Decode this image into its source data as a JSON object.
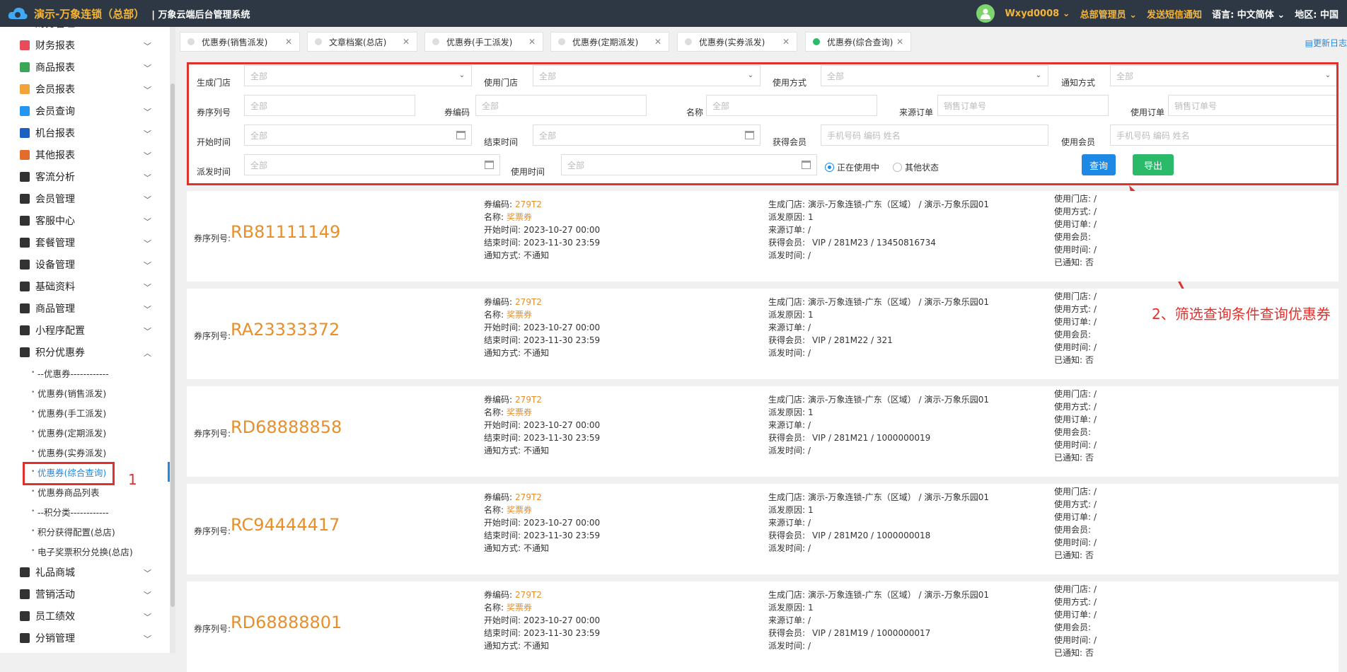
{
  "header": {
    "brand": "演示-万象连锁（总部）",
    "separator": "|",
    "system_name": "万象云端后台管理系统",
    "user": "Wxyd0008",
    "role": "总部管理员",
    "sms": "发送短信通知",
    "language_label": "语言:",
    "language": "中文简体",
    "region_label": "地区:",
    "region": "中国"
  },
  "sidebar": {
    "cut_top": "财务管理",
    "items": [
      {
        "label": "财务报表",
        "icon": "bar-chart-icon",
        "color": "#e84c5a"
      },
      {
        "label": "商品报表",
        "icon": "bar-chart-icon",
        "color": "#3aa757"
      },
      {
        "label": "会员报表",
        "icon": "bar-chart-icon",
        "color": "#f2a33a"
      },
      {
        "label": "会员查询",
        "icon": "bar-chart-icon",
        "color": "#2196f3"
      },
      {
        "label": "机台报表",
        "icon": "bar-chart-icon",
        "color": "#1e5fc2"
      },
      {
        "label": "其他报表",
        "icon": "stack-icon",
        "color": "#e36b2c"
      },
      {
        "label": "客流分析",
        "icon": "target-icon",
        "color": "#333"
      },
      {
        "label": "会员管理",
        "icon": "user-icon",
        "color": "#333"
      },
      {
        "label": "客服中心",
        "icon": "headset-icon",
        "color": "#333"
      },
      {
        "label": "套餐管理",
        "icon": "edit-icon",
        "color": "#333"
      },
      {
        "label": "设备管理",
        "icon": "wrench-icon",
        "color": "#333"
      },
      {
        "label": "基础资料",
        "icon": "doc-icon",
        "color": "#333"
      },
      {
        "label": "商品管理",
        "icon": "swap-icon",
        "color": "#333"
      },
      {
        "label": "小程序配置",
        "icon": "gear-icon",
        "color": "#333"
      },
      {
        "label": "积分优惠券",
        "icon": "tag-icon",
        "color": "#333"
      }
    ],
    "subitems": [
      "--优惠券------------",
      "优惠券(销售派发)",
      "优惠券(手工派发)",
      "优惠券(定期派发)",
      "优惠券(实券派发)",
      "优惠券(综合查询)",
      "优惠券商品列表",
      "--积分类------------",
      "积分获得配置(总店)",
      "电子奖票积分兑换(总店)"
    ],
    "items_after": [
      {
        "label": "礼品商城",
        "icon": "tag-icon"
      },
      {
        "label": "营销活动",
        "icon": "tag-icon"
      },
      {
        "label": "员工绩效",
        "icon": "gear-icon"
      },
      {
        "label": "分销管理",
        "icon": "users-icon"
      }
    ]
  },
  "tabs": [
    {
      "label": "优惠券(销售派发)",
      "active": false
    },
    {
      "label": "文章档案(总店)",
      "active": false
    },
    {
      "label": "优惠券(手工派发)",
      "active": false
    },
    {
      "label": "优惠券(定期派发)",
      "active": false
    },
    {
      "label": "优惠券(实券派发)",
      "active": false
    },
    {
      "label": "优惠券(综合查询)",
      "active": true
    }
  ],
  "update_log": "更新日志",
  "filters": {
    "gen_store": {
      "label": "生成门店",
      "value": "全部"
    },
    "use_store": {
      "label": "使用门店",
      "value": "全部"
    },
    "use_method": {
      "label": "使用方式",
      "value": "全部"
    },
    "notify_method": {
      "label": "通知方式",
      "value": "全部"
    },
    "serial": {
      "label": "券序列号",
      "placeholder": "全部"
    },
    "code": {
      "label": "券编码",
      "placeholder": "全部"
    },
    "name": {
      "label": "名称",
      "placeholder": "全部"
    },
    "src_order": {
      "label": "来源订单",
      "placeholder": "销售订单号"
    },
    "use_order": {
      "label": "使用订单",
      "placeholder": "销售订单号"
    },
    "start_time": {
      "label": "开始时间",
      "placeholder": "全部"
    },
    "end_time": {
      "label": "结束时间",
      "placeholder": "全部"
    },
    "gain_member": {
      "label": "获得会员",
      "placeholder": "手机号码 编码 姓名"
    },
    "use_member": {
      "label": "使用会员",
      "placeholder": "手机号码 编码 姓名"
    },
    "dispatch_time": {
      "label": "派发时间",
      "placeholder": "全部"
    },
    "use_time": {
      "label": "使用时间",
      "placeholder": "全部"
    },
    "radio_using": "正在使用中",
    "radio_other": "其他状态",
    "query_button": "查询",
    "export_button": "导出",
    "query_color": "#1e88e5",
    "export_color": "#2bba6a"
  },
  "labels": {
    "serial_label": "券序列号:",
    "code": "券编码:",
    "name": "名称:",
    "start": "开始时间:",
    "end": "结束时间:",
    "notify": "通知方式:",
    "gen_store": "生成门店:",
    "dispatch_reason": "派发原因:",
    "src_order": "来源订单:",
    "gain_member": "获得会员:",
    "dispatch_time": "派发时间:",
    "use_store": "使用门店:",
    "use_method": "使用方式:",
    "use_order": "使用订单:",
    "use_member": "使用会员:",
    "use_time": "使用时间:",
    "notified": "已通知:"
  },
  "coupons": [
    {
      "serial": "RB81111149",
      "code": "279T2",
      "name": "奖票券",
      "start": "2023-10-27 00:00",
      "end": "2023-11-30 23:59",
      "notify": "不通知",
      "gen_store": "演示-万象连锁-广东（区域） / 演示-万象乐园01",
      "dispatch_reason": "1",
      "src_order": "/",
      "gain_member": "VIP / 281M23 / 13450816734",
      "dispatch_time": "/",
      "use_store": "/",
      "use_method": "/",
      "use_order": "/",
      "use_member": "",
      "use_time": "/",
      "notified": "否"
    },
    {
      "serial": "RA23333372",
      "code": "279T2",
      "name": "奖票券",
      "start": "2023-10-27 00:00",
      "end": "2023-11-30 23:59",
      "notify": "不通知",
      "gen_store": "演示-万象连锁-广东（区域） / 演示-万象乐园01",
      "dispatch_reason": "1",
      "src_order": "/",
      "gain_member": "VIP / 281M22 / 321",
      "dispatch_time": "/",
      "use_store": "/",
      "use_method": "/",
      "use_order": "/",
      "use_member": "",
      "use_time": "/",
      "notified": "否"
    },
    {
      "serial": "RD68888858",
      "code": "279T2",
      "name": "奖票券",
      "start": "2023-10-27 00:00",
      "end": "2023-11-30 23:59",
      "notify": "不通知",
      "gen_store": "演示-万象连锁-广东（区域） / 演示-万象乐园01",
      "dispatch_reason": "1",
      "src_order": "/",
      "gain_member": "VIP / 281M21 / 1000000019",
      "dispatch_time": "/",
      "use_store": "/",
      "use_method": "/",
      "use_order": "/",
      "use_member": "",
      "use_time": "/",
      "notified": "否"
    },
    {
      "serial": "RC94444417",
      "code": "279T2",
      "name": "奖票券",
      "start": "2023-10-27 00:00",
      "end": "2023-11-30 23:59",
      "notify": "不通知",
      "gen_store": "演示-万象连锁-广东（区域） / 演示-万象乐园01",
      "dispatch_reason": "1",
      "src_order": "/",
      "gain_member": "VIP / 281M20 / 1000000018",
      "dispatch_time": "/",
      "use_store": "/",
      "use_method": "/",
      "use_order": "/",
      "use_member": "",
      "use_time": "/",
      "notified": "否"
    },
    {
      "serial": "RD68888801",
      "code": "279T2",
      "name": "奖票券",
      "start": "2023-10-27 00:00",
      "end": "2023-11-30 23:59",
      "notify": "不通知",
      "gen_store": "演示-万象连锁-广东（区域） / 演示-万象乐园01",
      "dispatch_reason": "1",
      "src_order": "/",
      "gain_member": "VIP / 281M19 / 1000000017",
      "dispatch_time": "/",
      "use_store": "/",
      "use_method": "/",
      "use_order": "/",
      "use_member": "",
      "use_time": "/",
      "notified": "否"
    }
  ],
  "annotations": {
    "step1": "1",
    "step2": "2、筛选查询条件查询优惠券",
    "color": "#e0312c"
  }
}
